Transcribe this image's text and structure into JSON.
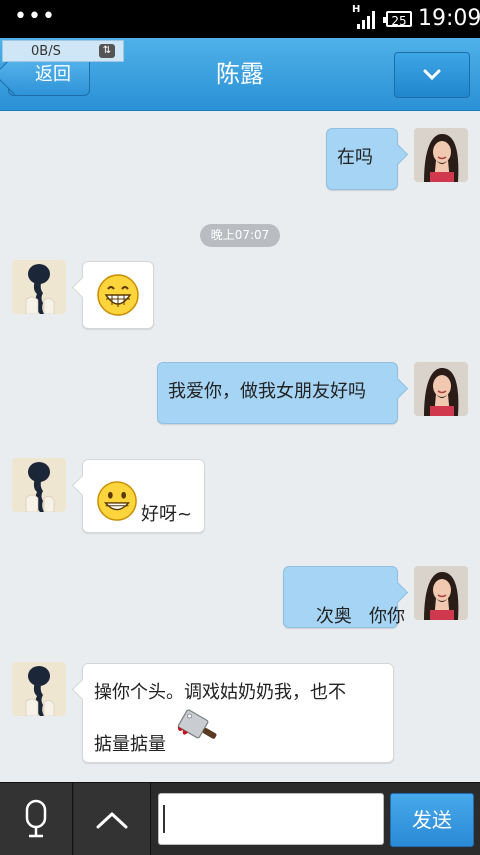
{
  "status_bar": {
    "time": "19:09",
    "battery": "25",
    "network_type": "H",
    "menu_dots": "•••"
  },
  "net_speed": {
    "value": "0B/S",
    "icon": "up-down-arrows-icon"
  },
  "header": {
    "back_label": "返回",
    "title": "陈露",
    "menu_icon": "chevron-down-icon"
  },
  "messages": [
    {
      "direction": "out",
      "text": "在吗"
    },
    {
      "type": "timestamp",
      "text": "晚上07:07"
    },
    {
      "direction": "in",
      "emoji": "grinning-face-icon"
    },
    {
      "direction": "out",
      "text": "我爱你，做我女朋友好吗"
    },
    {
      "direction": "in",
      "emoji": "smiling-face-icon",
      "text": "好呀~"
    },
    {
      "direction": "out",
      "text": "次奥   你你"
    },
    {
      "direction": "in",
      "text_line1": "操你个头。调戏姑奶奶我，也不",
      "text_line2": "掂量掂量",
      "emoji": "cleaver-knife-icon"
    }
  ],
  "input": {
    "value": "",
    "placeholder": ""
  },
  "bottom_bar": {
    "voice_icon": "microphone-icon",
    "expand_icon": "chevron-up-icon",
    "send_label": "发送"
  },
  "colors": {
    "header_blue": "#2b91d6",
    "outgoing_bubble": "#a6d4f4",
    "incoming_bubble": "#ffffff",
    "chat_bg": "#e9edf0"
  }
}
